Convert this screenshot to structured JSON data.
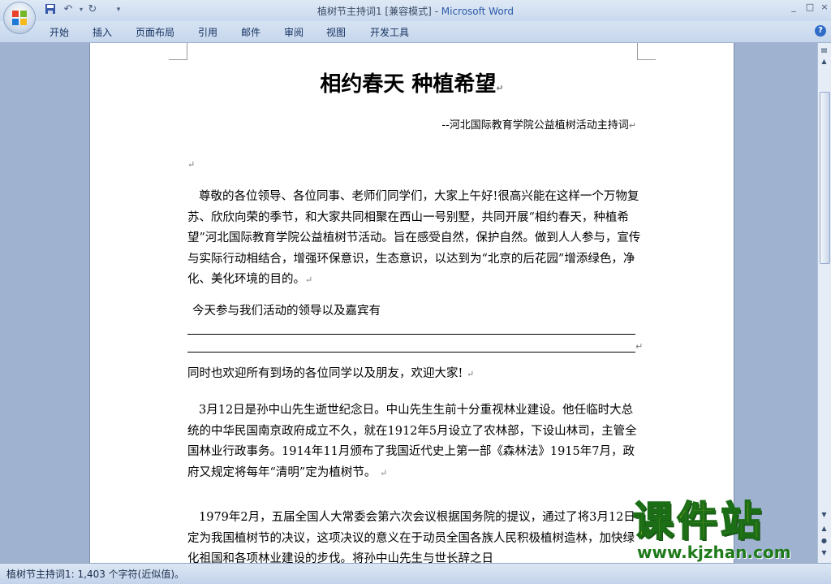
{
  "window": {
    "title": "植树节主持词1 [兼容模式]",
    "title_sep": " - ",
    "app_name": "Microsoft Word",
    "controls": [
      "_",
      "□",
      "×"
    ]
  },
  "quick_access": [
    "save-icon",
    "undo-icon",
    "redo-icon",
    "customize-icon"
  ],
  "ribbon": {
    "tabs": [
      "开始",
      "插入",
      "页面布局",
      "引用",
      "邮件",
      "审阅",
      "视图",
      "开发工具"
    ],
    "help_label": "?"
  },
  "document": {
    "title": "相约春天 种植希望",
    "subtitle": "--河北国际教育学院公益植树活动主持词",
    "paragraphs": [
      "尊敬的各位领导、各位同事、老师们同学们，大家上午好!很高兴能在这样一个万物复苏、欣欣向荣的季节，和大家共同相聚在西山一号别墅，共同开展“相约春天，种植希望”河北国际教育学院公益植树节活动。旨在感受自然，保护自然。做到人人参与，宣传与实际行动相结合，增强环保意识，生态意识，以达到为“北京的后花园”增添绿色，净化、美化环境的目的。",
      "今天参与我们活动的领导以及嘉宾有",
      "同时也欢迎所有到场的各位同学以及朋友，欢迎大家!",
      "3月12日是孙中山先生逝世纪念日。中山先生生前十分重视林业建设。他任临时大总统的中华民国南京政府成立不久，就在1912年5月设立了农林部，下设山林司，主管全国林业行政事务。1914年11月颁布了我国近代史上第一部《森林法》1915年7月，政府又规定将每年“清明”定为植树节。",
      "1979年2月，五届全国人大常委会第六次会议根据国务院的提议，通过了将3月12日定为我国植树节的决议，这项决议的意义在于动员全国各族人民积极植树造林，加快绿化祖国和各项林业建设的步伐。将孙中山先生与世长辞之日"
    ],
    "paragraph_mark": "↵"
  },
  "status_bar": {
    "text": "植树节主持词1: 1,403 个字符(近似值)。"
  },
  "watermark": {
    "text": "课件站",
    "url": "www.kjzhan.com"
  }
}
